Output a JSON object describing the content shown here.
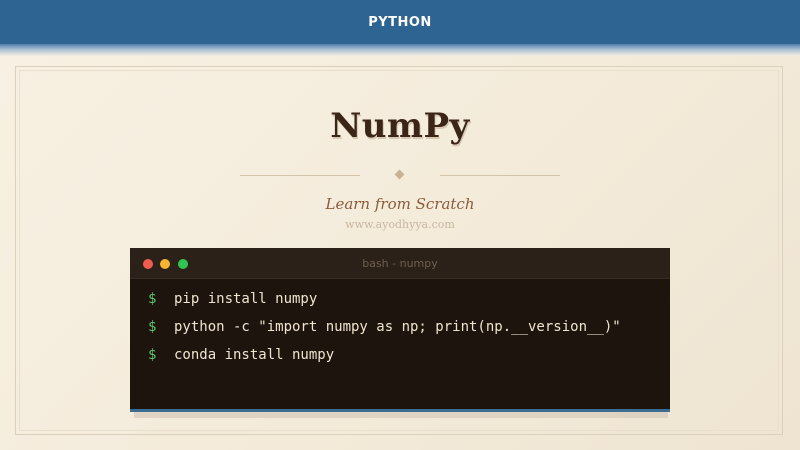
{
  "header": {
    "label": "PYTHON"
  },
  "hero": {
    "title": "NumPy",
    "subtitle": "Learn from Scratch",
    "website": "www.ayodhyya.com"
  },
  "terminal": {
    "title": "bash - numpy",
    "window_buttons": [
      "close",
      "minimize",
      "maximize"
    ],
    "prompt": "$",
    "commands": [
      "pip install numpy",
      "python -c \"import numpy as np; print(np.__version__)\"",
      "conda install numpy"
    ]
  },
  "colors": {
    "header_bg": "#2e6492",
    "title_text": "#3a2517",
    "subtitle_text": "#8a5c3b",
    "terminal_bg": "#1d140d",
    "prompt": "#5bc66a",
    "close_dot": "#f25b4f",
    "minimize_dot": "#f6b430",
    "maximize_dot": "#2fc552"
  }
}
